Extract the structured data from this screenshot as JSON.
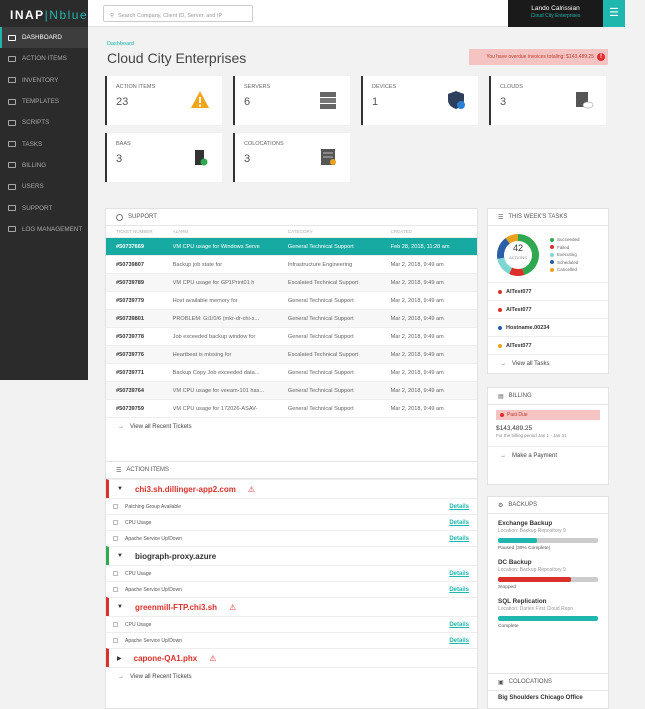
{
  "brand": {
    "part1": "INAP",
    "sep": "|",
    "part2": "Nblue"
  },
  "nav": [
    {
      "label": "DASHBOARD",
      "active": true
    },
    {
      "label": "ACTION ITEMS"
    },
    {
      "label": "INVENTORY"
    },
    {
      "label": "TEMPLATES"
    },
    {
      "label": "SCRIPTS"
    },
    {
      "label": "TASKS"
    },
    {
      "label": "BILLING"
    },
    {
      "label": "USERS"
    },
    {
      "label": "SUPPORT"
    },
    {
      "label": "LOG MANAGEMENT"
    }
  ],
  "search": {
    "placeholder": "Search Company, Client ID, Server, and IP"
  },
  "user": {
    "name": "Lando Calrissian",
    "company": "Cloud City Enterprises"
  },
  "breadcrumb": "Dashboard",
  "page_title": "Cloud City Enterprises",
  "alert": "You have overdue invoices totaling: $143,489.25",
  "stats": [
    {
      "label": "ACTION ITEMS",
      "value": "23",
      "icon": "warning-icon"
    },
    {
      "label": "SERVERS",
      "value": "6",
      "icon": "server-icon"
    },
    {
      "label": "DEVICES",
      "value": "1",
      "icon": "shield-icon"
    },
    {
      "label": "CLOUDS",
      "value": "3",
      "icon": "cloud-server-icon"
    },
    {
      "label": "BAAS",
      "value": "3",
      "icon": "backup-icon"
    },
    {
      "label": "COLOCATIONS",
      "value": "3",
      "icon": "colocation-icon"
    }
  ],
  "support": {
    "title": "SUPPORT",
    "headers": [
      "TICKET NUMBER",
      "ALARM",
      "CATEGORY",
      "CREATED"
    ],
    "rows": [
      [
        "#50737669",
        "VM CPU usage for Windows Serve",
        "General Technical Support",
        "Feb 28, 2018, 11:28 am"
      ],
      [
        "#50739807",
        "Backup job state for",
        "Infrastructure Engineering",
        "Mar 2, 2018, 9:49 am"
      ],
      [
        "#50739789",
        "VM CPU usage for GP1Print01 h",
        "Escalated Technical Support",
        "Mar 2, 2018, 9:49 am"
      ],
      [
        "#50739779",
        "Host available memory for",
        "General Technical Support",
        "Mar 2, 2018, 9:49 am"
      ],
      [
        "#50739801",
        "PROBLEM: Gi1/0/6 (mkr-dr-chi-s...",
        "General Technical Support",
        "Mar 2, 2018, 9:49 am"
      ],
      [
        "#50739778",
        "Job exceeded backup window for",
        "General Technical Support",
        "Mar 2, 2018, 9:49 am"
      ],
      [
        "#50739776",
        "Heartbeat is missing for",
        "Escalated Technical Support",
        "Mar 2, 2018, 9:49 am"
      ],
      [
        "#50739771",
        "Backup Copy Job exceeded data...",
        "General Technical Support",
        "Mar 2, 2018, 9:49 am"
      ],
      [
        "#50739764",
        "VM CPU usage for veeam-101 has...",
        "General Technical Support",
        "Mar 2, 2018, 9:49 am"
      ],
      [
        "#50739759",
        "VM CPU usage for 172026-ASAV-",
        "General Technical Support",
        "Mar 2, 2018, 9:49 am"
      ]
    ],
    "view_all": "View all Recent Tickets"
  },
  "action_items": {
    "title": "ACTION ITEMS",
    "groups": [
      {
        "name": "chi3.sh.dillinger-app2.com",
        "status": "error",
        "expanded": true,
        "items": [
          {
            "label": "Patching Group Available",
            "link": "Details"
          },
          {
            "label": "CPU Usage",
            "link": "Details"
          },
          {
            "label": "Apache Service Up/Down",
            "link": "Details"
          }
        ]
      },
      {
        "name": "biograph-proxy.azure",
        "status": "ok",
        "expanded": true,
        "items": [
          {
            "label": "CPU Usage",
            "link": "Details"
          },
          {
            "label": "Apache Service Up/Down",
            "link": "Details"
          }
        ]
      },
      {
        "name": "greenmill-FTP.chi3.sh",
        "status": "error",
        "expanded": true,
        "items": [
          {
            "label": "CPU Usage",
            "link": "Details"
          },
          {
            "label": "Apache Service Up/Down",
            "link": "Details"
          }
        ]
      },
      {
        "name": "capone-QA1.phx",
        "status": "error",
        "expanded": false,
        "items": []
      }
    ],
    "view_all": "View all Recent Tickets"
  },
  "tasks": {
    "title": "THIS WEEK'S TASKS",
    "count": "42",
    "count_label": "ACTIONS",
    "legend": [
      {
        "label": "Succeeded",
        "color": "#2fa84f"
      },
      {
        "label": "Failed",
        "color": "#d9302b"
      },
      {
        "label": "Executing",
        "color": "#7fd6d0"
      },
      {
        "label": "Scheduled",
        "color": "#2a5ea8"
      },
      {
        "label": "Cancelled",
        "color": "#e8a21d"
      }
    ],
    "items": [
      {
        "label": "AITest077",
        "color": "#d9302b"
      },
      {
        "label": "AITest077",
        "color": "#d9302b"
      },
      {
        "label": "Hostname.00234",
        "color": "#2a5ea8"
      },
      {
        "label": "AITest077",
        "color": "#e8a21d"
      }
    ],
    "view_all": "View all Tasks"
  },
  "billing": {
    "title": "BILLING",
    "status": "Past Due",
    "amount": "$143,489.25",
    "period": "For the billing period Jan 1 - Jan 31",
    "action": "Make a Payment"
  },
  "backups": {
    "title": "BACKUPS",
    "items": [
      {
        "name": "Exchange Backup",
        "location": "Location: Backup Repository 9",
        "status": "Paused (39% Complete)",
        "progress": 0.39,
        "color": "#1fb7ad"
      },
      {
        "name": "DC Backup",
        "location": "Location: Backup Repository 9",
        "status": "Stopped",
        "progress": 0.73,
        "color": "#d9302b"
      },
      {
        "name": "SQL Replication",
        "location": "Location: Daries First Cloud Repo",
        "status": "Complete",
        "progress": 1.0,
        "color": "#1fb7ad"
      }
    ]
  },
  "colocations": {
    "title": "COLOCATIONS",
    "first": "Big Shoulders Chicago Office"
  }
}
